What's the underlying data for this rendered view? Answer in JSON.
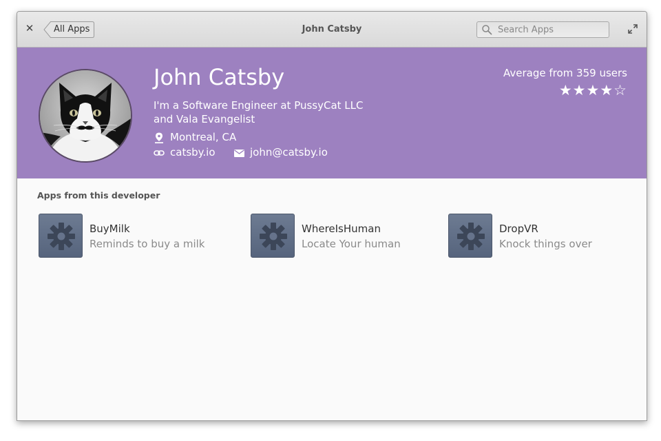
{
  "window": {
    "title": "John Catsby",
    "back_label": "All Apps",
    "search_placeholder": "Search Apps",
    "close_glyph": "✕"
  },
  "developer": {
    "name": "John Catsby",
    "bio_line1": "I'm a Software Engineer at PussyCat LLC",
    "bio_line2": "and Vala Evangelist",
    "location": "Montreal, CA",
    "website": "catsby.io",
    "email": "john@catsby.io",
    "rating_label": "Average from 359 users",
    "rating_stars": 4,
    "rating_max": 5,
    "stars_text": "★★★★☆"
  },
  "apps_section": {
    "title": "Apps from this developer",
    "apps": [
      {
        "name": "BuyMilk",
        "description": "Reminds to buy a milk",
        "icon": "gear-icon"
      },
      {
        "name": "WhereIsHuman",
        "description": "Locate Your human",
        "icon": "gear-icon"
      },
      {
        "name": "DropVR",
        "description": "Knock things over",
        "icon": "gear-icon"
      }
    ]
  },
  "colors": {
    "banner": "#9d81c0",
    "app_icon": "#5f6c84"
  }
}
